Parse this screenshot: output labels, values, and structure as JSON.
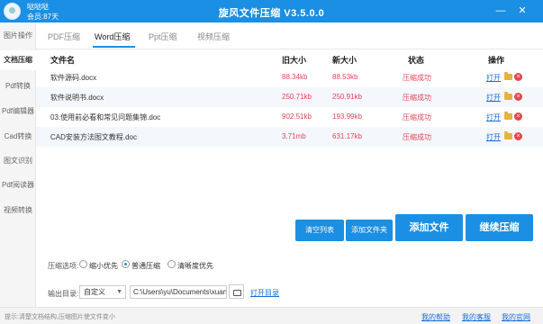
{
  "user": {
    "name": "哒哒哒",
    "vip": "会员:87天"
  },
  "app": {
    "title": "旋风文件压缩 V3.5.0.0"
  },
  "window": {
    "minimize_icon": "minimize-icon",
    "close_icon": "close-icon"
  },
  "sidebar": {
    "items": [
      {
        "label": "图片操作"
      },
      {
        "label": "文档压缩",
        "active": true
      },
      {
        "label": "Pdf转换"
      },
      {
        "label": "Pdf编辑器"
      },
      {
        "label": "Cad转换"
      },
      {
        "label": "图文识别"
      },
      {
        "label": "Pdf阅读器"
      },
      {
        "label": "视频转换"
      }
    ]
  },
  "tabs": [
    {
      "label": "PDF压缩"
    },
    {
      "label": "Word压缩",
      "active": true
    },
    {
      "label": "Ppt压缩"
    },
    {
      "label": "视频压缩"
    }
  ],
  "table": {
    "headers": {
      "name": "文件名",
      "old_size": "旧大小",
      "new_size": "新大小",
      "status": "状态",
      "actions": "操作"
    },
    "rows": [
      {
        "name": "软件源码.docx",
        "old_size": "88.34kb",
        "new_size": "88.53kb",
        "status": "压缩成功",
        "open": "打开"
      },
      {
        "name": "软件说明书.docx",
        "old_size": "250.71kb",
        "new_size": "250.91kb",
        "status": "压缩成功",
        "open": "打开"
      },
      {
        "name": "03.使用前必看和常见问题集锦.doc",
        "old_size": "902.51kb",
        "new_size": "193.99kb",
        "status": "压缩成功",
        "open": "打开"
      },
      {
        "name": "CAD安装方法图文教程.doc",
        "old_size": "3.71mb",
        "new_size": "631.17kb",
        "status": "压缩成功",
        "open": "打开"
      }
    ]
  },
  "buttons": {
    "clear": "清空列表",
    "add_folder": "添加文件夹",
    "add_file": "添加文件",
    "continue": "继续压缩"
  },
  "options": {
    "label": "压缩选项:",
    "choices": [
      {
        "label": "缩小优先",
        "checked": false
      },
      {
        "label": "普通压缩",
        "checked": true
      },
      {
        "label": "清晰度优先",
        "checked": false
      }
    ]
  },
  "output": {
    "label": "输出目录:",
    "mode": "自定义",
    "path": "C:\\Users\\yu\\Documents\\xuanfeng",
    "open_dir": "打开目录"
  },
  "status_bar": {
    "text": "提示:清楚文档结构,压缩图片使文件变小",
    "links": {
      "help": "我的帮助",
      "service": "我的客服",
      "website": "我的官网"
    }
  },
  "colors": {
    "accent": "#1a8fe3",
    "error_red": "#e0475a",
    "link": "#1a6fd8"
  }
}
